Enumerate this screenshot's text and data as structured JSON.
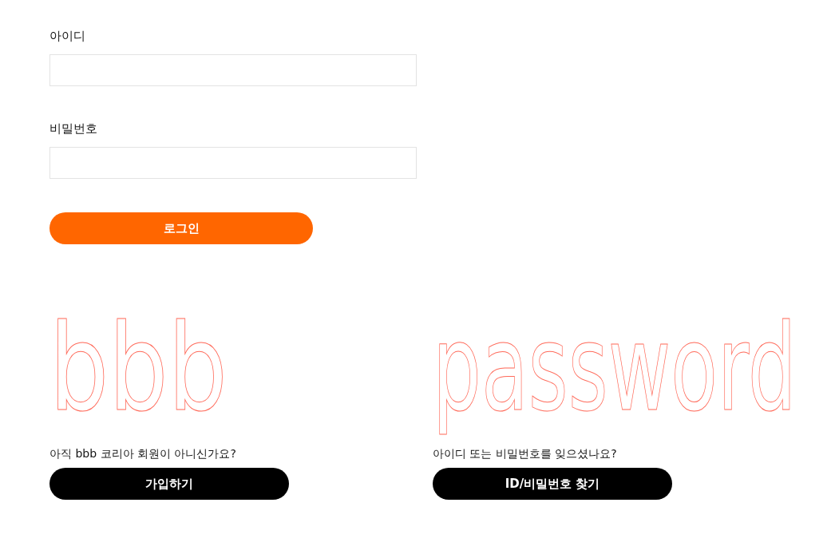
{
  "login_form": {
    "fields": [
      {
        "label": "아이디"
      },
      {
        "label": "비밀번호"
      }
    ],
    "submit": "로그인"
  },
  "panels": [
    {
      "outline_text": "bbb",
      "question": "아직 bbb 코리아 회원이 아니신가요?",
      "button": "가입하기"
    },
    {
      "outline_text": "password",
      "question": "아이디 또는 비밀번호를 잊으셨나요?",
      "button": "ID/비밀번호 찾기"
    }
  ]
}
